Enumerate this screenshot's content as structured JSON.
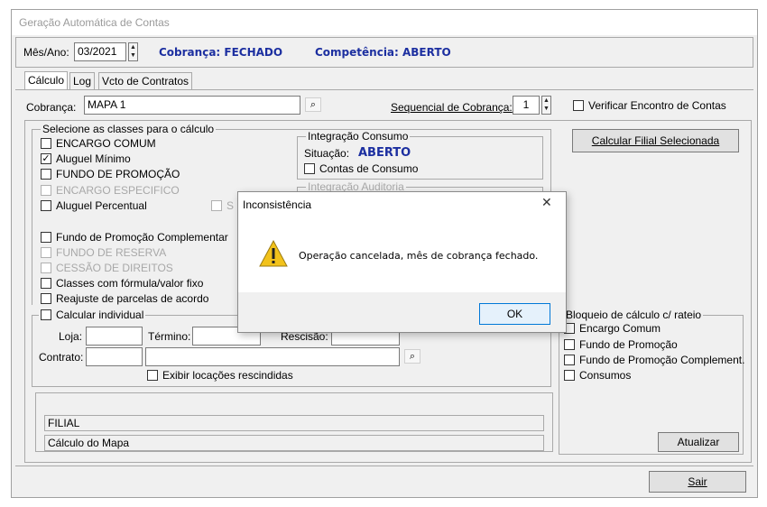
{
  "window": {
    "title": "Geração Automática de Contas"
  },
  "header": {
    "mes_ano_label": "Mês/Ano:",
    "mes_ano_value": "03/2021",
    "cobranca_status": "Cobrança: FECHADO",
    "competencia_status": "Competência: ABERTO"
  },
  "tabs": [
    "Cálculo",
    "Log",
    "Vcto de Contratos"
  ],
  "cobranca": {
    "label": "Cobrança:",
    "value": "MAPA 1",
    "sequencial_label": "Sequencial de Cobrança:",
    "sequencial_value": "1",
    "verificar_label": "Verificar Encontro de Contas"
  },
  "classes": {
    "legend": "Selecione as classes para o cálculo",
    "items": [
      {
        "label": "ENCARGO COMUM",
        "checked": false,
        "enabled": true
      },
      {
        "label": "Aluguel Mínimo",
        "checked": true,
        "enabled": true
      },
      {
        "label": "FUNDO DE PROMOÇÃO",
        "checked": false,
        "enabled": true
      },
      {
        "label": "ENCARGO ESPECIFICO",
        "checked": false,
        "enabled": false
      },
      {
        "label": "Aluguel Percentual",
        "checked": false,
        "enabled": true
      },
      {
        "label": "Fundo de Promoção Complementar",
        "checked": false,
        "enabled": true
      },
      {
        "label": "FUNDO DE RESERVA",
        "checked": false,
        "enabled": false
      },
      {
        "label": "CESSÃO DE DIREITOS",
        "checked": false,
        "enabled": false
      },
      {
        "label": "Classes com fórmula/valor fixo",
        "checked": false,
        "enabled": true
      },
      {
        "label": "Reajuste de parcelas de acordo",
        "checked": false,
        "enabled": true
      }
    ],
    "partial_label": "S"
  },
  "integracao_consumo": {
    "legend": "Integração Consumo",
    "situacao_label": "Situação:",
    "situacao_value": "ABERTO",
    "contas_label": "Contas de Consumo"
  },
  "integracao_auditoria": {
    "legend": "Integração Auditoria"
  },
  "calcular_filial_button": "Calcular Filial Selecionada",
  "individual": {
    "label": "Calcular individual",
    "loja_label": "Loja:",
    "termino_label": "Término:",
    "rescisao_label": "Rescisão:",
    "contrato_label": "Contrato:",
    "exibir_label": "Exibir locações rescindidas"
  },
  "status": {
    "filial": "FILIAL",
    "calculo": "Cálculo do Mapa"
  },
  "bloqueio": {
    "legend": "Bloqueio de cálculo c/ rateio",
    "items": [
      "Encargo Comum",
      "Fundo de Promoção",
      "Fundo de Promoção Complement.",
      "Consumos"
    ],
    "atualizar_button": "Atualizar"
  },
  "sair_button": "Sair",
  "dialog": {
    "title": "Inconsistência",
    "message": "Operação cancelada, mês de cobrança fechado.",
    "ok_button": "OK",
    "close_glyph": "✕"
  }
}
